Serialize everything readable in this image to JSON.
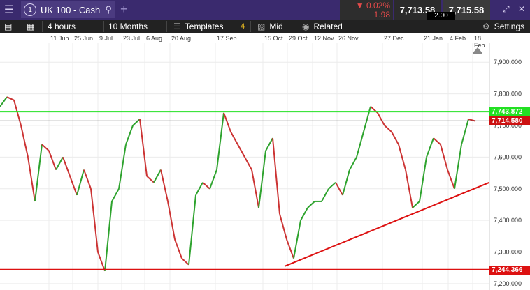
{
  "window": {
    "instrument_number": "1",
    "instrument": "UK 100 - Cash",
    "change_pct": "0.02%",
    "change_abs": "1.98",
    "sell": "7,713.58",
    "buy": "7,715.58",
    "spread": "2.00",
    "add_label": "+"
  },
  "toolbar": {
    "timeframe": "4 hours",
    "range": "10 Months",
    "templates": "Templates",
    "templates_count": "4",
    "price_type": "Mid",
    "related": "Related",
    "settings": "Settings"
  },
  "date_labels": [
    "11 Jun",
    "25 Jun",
    "9 Jul",
    "23 Jul",
    "6 Aug",
    "20 Aug",
    "17 Sep",
    "15 Oct",
    "29 Oct",
    "12 Nov",
    "26 Nov",
    "27 Dec",
    "21 Jan",
    "4 Feb",
    "18 Feb"
  ],
  "chart_data": {
    "type": "line",
    "ylim": [
      7180,
      7960
    ],
    "y_ticks": [
      "7,900.000",
      "7,800.000",
      "7,700.000",
      "7,600.000",
      "7,500.000",
      "7,400.000",
      "7,300.000",
      "7,200.000"
    ],
    "y_tick_values": [
      7900,
      7800,
      7700,
      7600,
      7500,
      7400,
      7300,
      7200
    ],
    "x": [
      0,
      10,
      20,
      30,
      40,
      50,
      60,
      70,
      80,
      90,
      100,
      110,
      120,
      130,
      140,
      150,
      160,
      170,
      180,
      190,
      200,
      210,
      220,
      230,
      240,
      250,
      260,
      270,
      280,
      290,
      300,
      310,
      320,
      330,
      340,
      350,
      360,
      370,
      380,
      390,
      400,
      410,
      420,
      430,
      440,
      450,
      460,
      470,
      480,
      490,
      500,
      510,
      520,
      530,
      540,
      550,
      560,
      570,
      580,
      590,
      600,
      610,
      620,
      630,
      640,
      650,
      660,
      670,
      680
    ],
    "values": [
      7760,
      7790,
      7780,
      7700,
      7600,
      7460,
      7640,
      7620,
      7560,
      7600,
      7540,
      7480,
      7560,
      7500,
      7300,
      7240,
      7460,
      7500,
      7640,
      7700,
      7720,
      7540,
      7520,
      7560,
      7460,
      7340,
      7280,
      7260,
      7480,
      7520,
      7500,
      7560,
      7740,
      7680,
      7640,
      7600,
      7560,
      7440,
      7620,
      7660,
      7420,
      7340,
      7280,
      7400,
      7440,
      7460,
      7460,
      7500,
      7520,
      7480,
      7560,
      7600,
      7680,
      7760,
      7740,
      7700,
      7680,
      7640,
      7560,
      7440,
      7460,
      7600,
      7660,
      7640,
      7560,
      7500,
      7640,
      7720,
      7714
    ],
    "colors": {
      "up": "#2ea32e",
      "down": "#cc3333",
      "resistance": "#22e022",
      "support": "#dd1111",
      "trend": "#dd1111",
      "current": "#222222"
    },
    "resistance_level": "7,743.872",
    "resistance_value": 7743.872,
    "support_level": "7,244.366",
    "support_value": 7244.366,
    "current_level": "7,714.580",
    "current_value": 7714.58,
    "trendline": [
      {
        "x": 407,
        "y": 7255
      },
      {
        "x": 700,
        "y": 7520
      }
    ]
  }
}
